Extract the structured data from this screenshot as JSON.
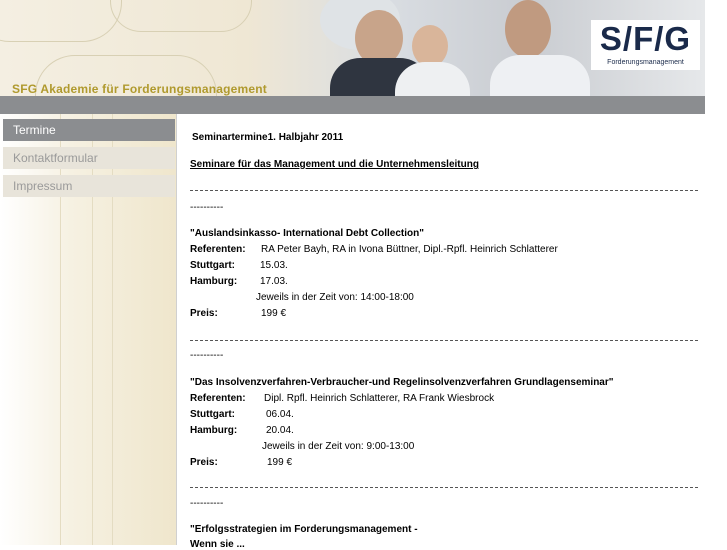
{
  "header": {
    "brand_title": "SFG Akademie für Forderungsmanagement",
    "logo_main": "S/F/G",
    "logo_sub": "Forderungsmanagement"
  },
  "nav": {
    "items": [
      {
        "label": "Termine",
        "active": true
      },
      {
        "label": "Kontaktformular",
        "active": false
      },
      {
        "label": "Impressum",
        "active": false
      }
    ]
  },
  "content": {
    "heading": "Seminartermine1. Halbjahr  2011",
    "subheading": "Seminare für das Management und die Unternehmensleitung",
    "separator": "----------",
    "seminars": [
      {
        "title": "\"Auslandsinkasso- International Debt Collection\"",
        "referenten_label": "Referenten:",
        "referenten": "RA Peter Bayh, RA in Ivona Büttner, Dipl.-Rpfl. Heinrich Schlatterer",
        "stuttgart_label": "Stuttgart:",
        "stuttgart": "15.03.",
        "hamburg_label": "Hamburg:",
        "hamburg": "17.03.",
        "time": "Jeweils in der Zeit von: 14:00-18:00",
        "preis_label": "Preis:",
        "preis": "199 €"
      },
      {
        "title": "\"Das Insolvenzverfahren-Verbraucher-und Regelinsolvenzverfahren Grundlagenseminar\"",
        "referenten_label": "Referenten:",
        "referenten": "Dipl. Rpfl. Heinrich Schlatterer, RA Frank Wiesbrock",
        "stuttgart_label": "Stuttgart:",
        "stuttgart": "06.04.",
        "hamburg_label": "Hamburg:",
        "hamburg": "20.04.",
        "time": "Jeweils in der Zeit von: 9:00-13:00",
        "preis_label": "Preis:",
        "preis": "199 €"
      },
      {
        "title": "\"Erfolgsstrategien im Forderungsmanagement -",
        "title_line2": "Wenn sie ..."
      }
    ]
  }
}
